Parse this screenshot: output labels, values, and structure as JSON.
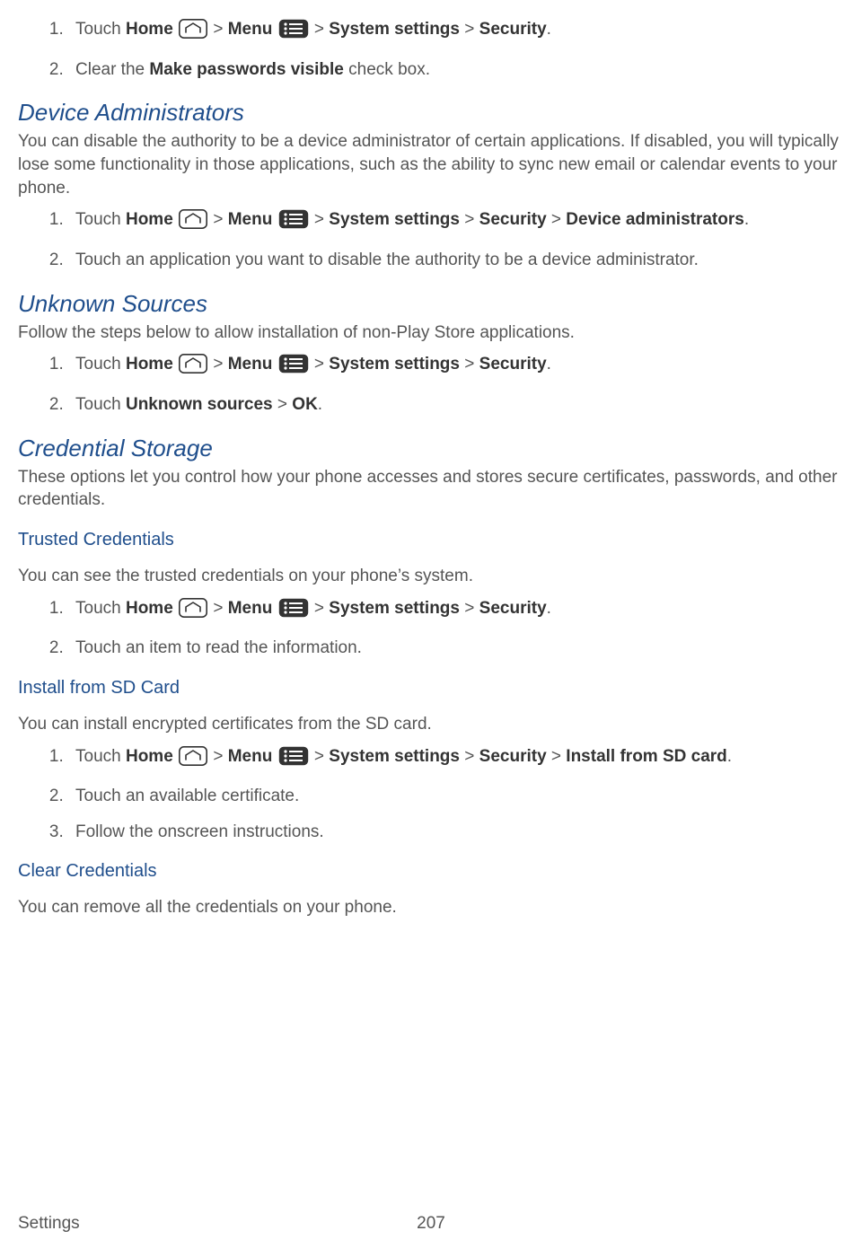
{
  "intro": {
    "steps": [
      {
        "pre": "Touch ",
        "home": "Home",
        "menu": "Menu",
        "tail1": "System settings",
        "tail2": "Security",
        "dot": "."
      },
      {
        "pre": "Clear the ",
        "b1": "Make passwords visible",
        "post": " check box."
      }
    ]
  },
  "sections": [
    {
      "title": "Device Administrators",
      "para": "You can disable the authority to be a device administrator of certain applications. If disabled, you will typically lose some functionality in those applications, such as the ability to sync new email or calendar events to your phone.",
      "steps": [
        {
          "pre": "Touch ",
          "home": "Home",
          "menu": "Menu",
          "tail1": "System settings",
          "tail2": "Security",
          "tail3": "Device administrators",
          "dot": "."
        },
        {
          "plain": "Touch an application you want to disable the authority to be a device administrator."
        }
      ]
    },
    {
      "title": "Unknown Sources",
      "para": "Follow the steps below to allow installation of non-Play Store applications.",
      "steps": [
        {
          "pre": "Touch ",
          "home": "Home",
          "menu": "Menu",
          "tail1": "System settings",
          "tail2": "Security",
          "dot": "."
        },
        {
          "pre": "Touch ",
          "b1": "Unknown sources",
          "sep": " > ",
          "b2": "OK",
          "dot": "."
        }
      ]
    },
    {
      "title": "Credential Storage",
      "para": "These options let you control how your phone accesses and stores secure certificates, passwords, and other credentials.",
      "subs": [
        {
          "title": "Trusted Credentials",
          "para": "You can see the trusted credentials on your phone’s system.",
          "steps": [
            {
              "pre": "Touch ",
              "home": "Home",
              "menu": "Menu",
              "tail1": "System settings",
              "tail2": "Security",
              "dot": "."
            },
            {
              "plain": "Touch an item to read the information."
            }
          ]
        },
        {
          "title": "Install from SD Card",
          "para": "You can install encrypted certificates from the SD card.",
          "steps": [
            {
              "pre": "Touch ",
              "home": "Home",
              "menu": "Menu",
              "tail1": "System settings",
              "tail2": "Security",
              "tail3": "Install from SD card",
              "dot": "."
            },
            {
              "plain": "Touch an available certificate."
            },
            {
              "plain": "Follow the onscreen instructions."
            }
          ]
        },
        {
          "title": "Clear Credentials",
          "para": "You can remove all the credentials on your phone."
        }
      ]
    }
  ],
  "footer": {
    "label": "Settings",
    "page": "207"
  }
}
